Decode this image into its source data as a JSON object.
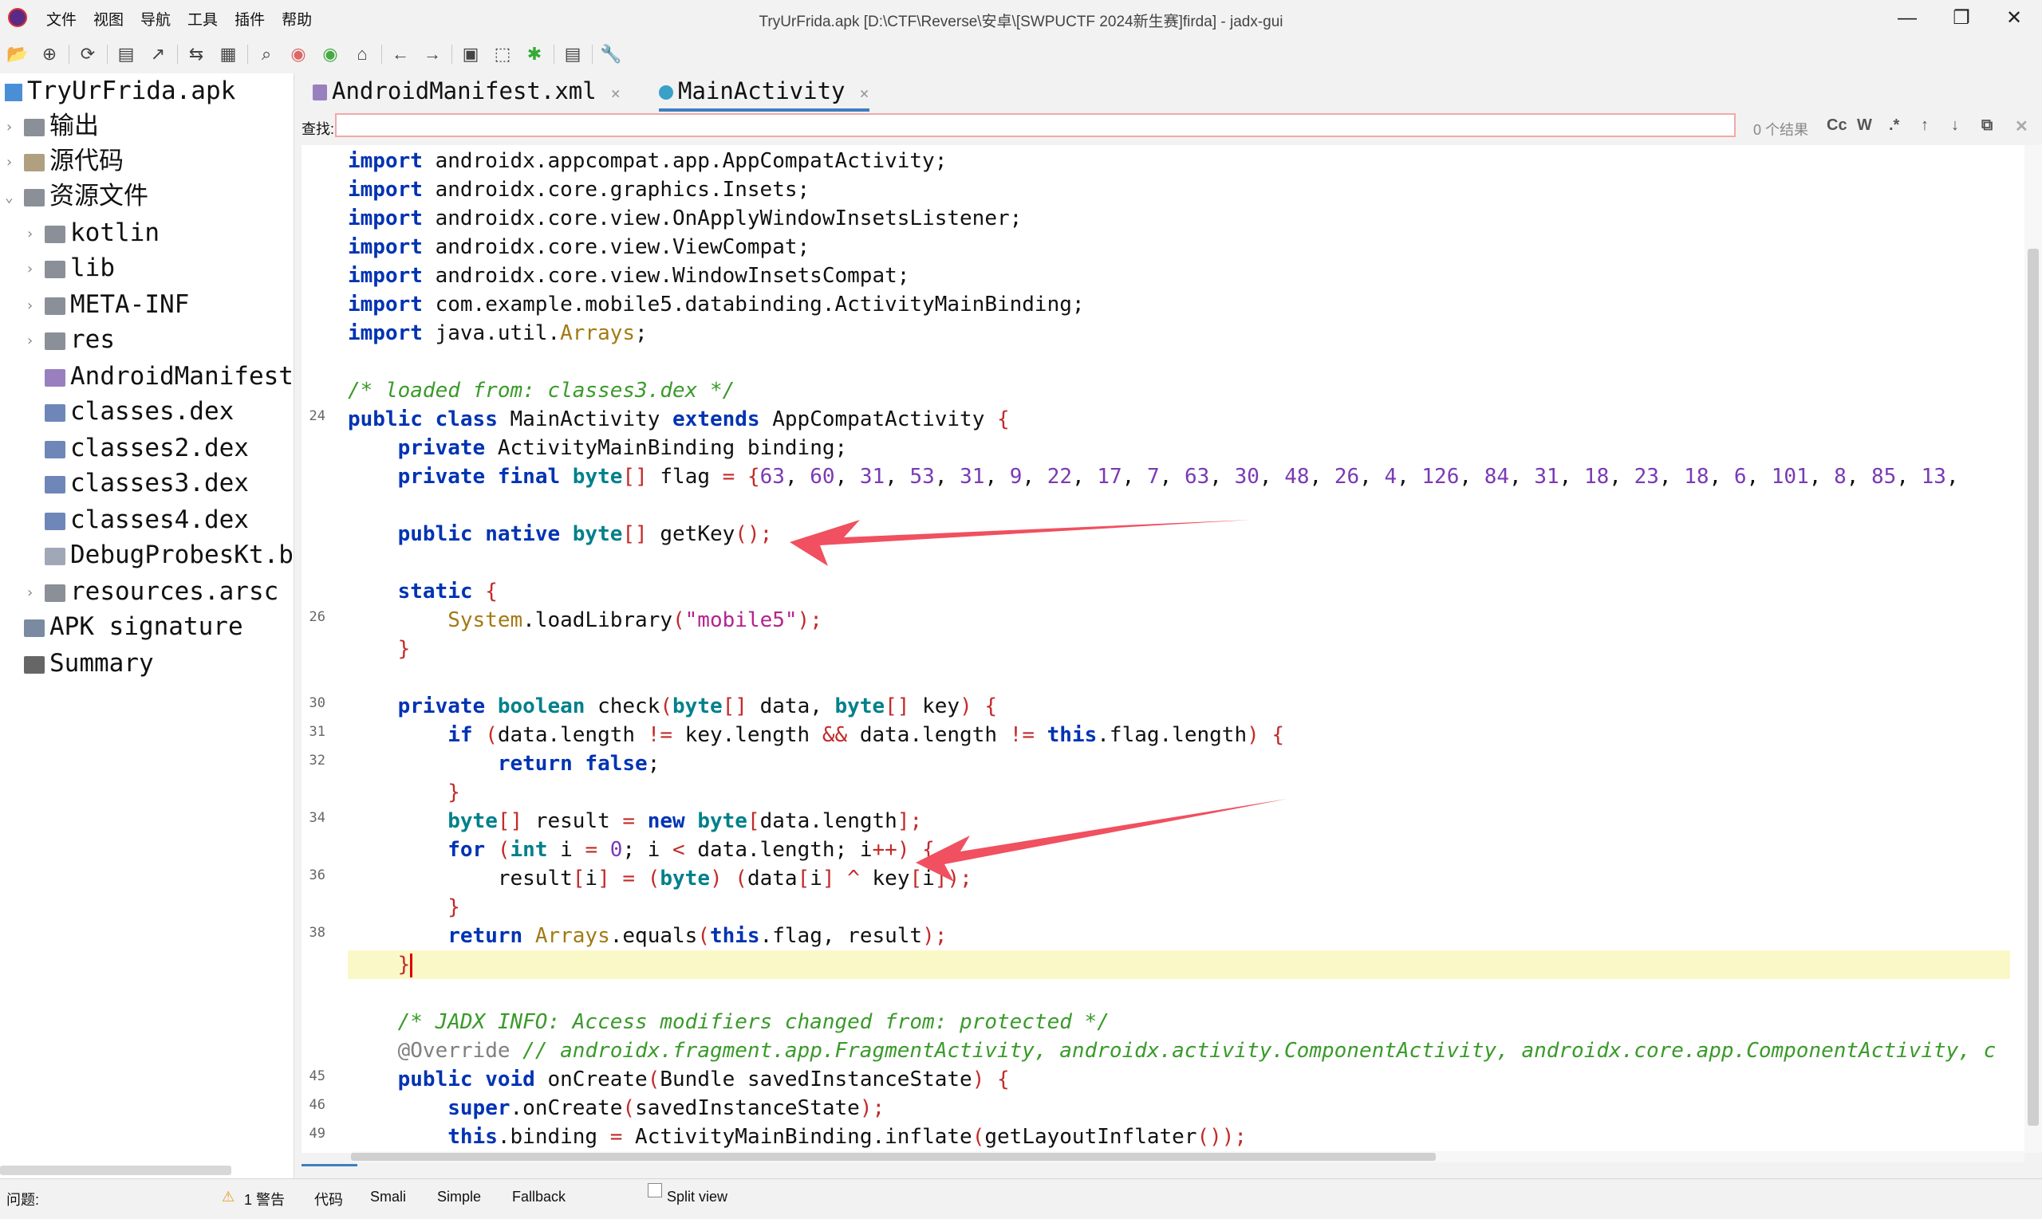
{
  "window": {
    "title": "TryUrFrida.apk [D:\\CTF\\Reverse\\安卓\\[SWPUCTF 2024新生赛]firda] - jadx-gui",
    "menu": [
      "文件",
      "视图",
      "导航",
      "工具",
      "插件",
      "帮助"
    ],
    "controls": {
      "minimize": "—",
      "maximize": "❐",
      "close": "✕"
    }
  },
  "toolbar": {
    "icons": [
      "open-file-icon",
      "add-files-icon",
      "reload-icon",
      "save-icon",
      "export-icon",
      "sync-tree-icon",
      "flatten-packages-icon",
      "search-icon",
      "find-class-icon",
      "usage-search-icon",
      "home-icon",
      "back-icon",
      "forward-icon",
      "quark-icon",
      "bookmark-icon",
      "debug-icon",
      "log-viewer-icon",
      "preferences-icon"
    ]
  },
  "tree": {
    "root": "TryUrFrida.apk",
    "items": [
      {
        "label": "输出",
        "arrow": "›"
      },
      {
        "label": "源代码",
        "arrow": "›"
      },
      {
        "label": "资源文件",
        "arrow": "⌄"
      },
      {
        "label": "kotlin",
        "arrow": "›"
      },
      {
        "label": "lib",
        "arrow": "›"
      },
      {
        "label": "META-INF",
        "arrow": "›"
      },
      {
        "label": "res",
        "arrow": "›"
      },
      {
        "label": "AndroidManifest",
        "arrow": ""
      },
      {
        "label": "classes.dex",
        "arrow": ""
      },
      {
        "label": "classes2.dex",
        "arrow": ""
      },
      {
        "label": "classes3.dex",
        "arrow": ""
      },
      {
        "label": "classes4.dex",
        "arrow": ""
      },
      {
        "label": "DebugProbesKt.b",
        "arrow": ""
      },
      {
        "label": "resources.arsc",
        "arrow": "›"
      },
      {
        "label": "APK signature",
        "arrow": ""
      },
      {
        "label": "Summary",
        "arrow": ""
      }
    ]
  },
  "tabs": [
    {
      "label": "AndroidManifest.xml",
      "close": "×"
    },
    {
      "label": "MainActivity",
      "close": "×"
    }
  ],
  "search": {
    "label": "查找:",
    "placeholder": "",
    "value": "",
    "result_count": "0 个结果",
    "buttons": [
      "Cc",
      "W",
      ".*",
      "↑",
      "↓",
      "⧉",
      "✕"
    ]
  },
  "editor": {
    "line_numbers": {
      "row8": "24",
      "row16": "26",
      "row19": "30",
      "row20": "31",
      "row21": "32",
      "row23": "34",
      "row25": "36",
      "row27": "38",
      "row32": "45",
      "row33": "46",
      "row34": "49"
    },
    "code_lines": [
      "import androidx.appcompat.app.AppCompatActivity;",
      "import androidx.core.graphics.Insets;",
      "import androidx.core.view.OnApplyWindowInsetsListener;",
      "import androidx.core.view.ViewCompat;",
      "import androidx.core.view.WindowInsetsCompat;",
      "import com.example.mobile5.databinding.ActivityMainBinding;",
      "import java.util.Arrays;",
      "",
      "/* loaded from: classes3.dex */",
      "public class MainActivity extends AppCompatActivity {",
      "    private ActivityMainBinding binding;",
      "    private final byte[] flag = {63, 60, 31, 53, 31, 9, 22, 17, 7, 63, 30, 48, 26, 4, 126, 84, 31, 18, 23, 18, 6, 101, 8, 85, 13,",
      "",
      "    public native byte[] getKey();",
      "",
      "    static {",
      "        System.loadLibrary(\"mobile5\");",
      "    }",
      "",
      "    private boolean check(byte[] data, byte[] key) {",
      "        if (data.length != key.length && data.length != this.flag.length) {",
      "            return false;",
      "        }",
      "        byte[] result = new byte[data.length];",
      "        for (int i = 0; i < data.length; i++) {",
      "            result[i] = (byte) (data[i] ^ key[i]);",
      "        }",
      "        return Arrays.equals(this.flag, result);",
      "    }",
      "",
      "    /* JADX INFO: Access modifiers changed from: protected */",
      "    @Override // androidx.fragment.app.FragmentActivity, androidx.activity.ComponentActivity, androidx.core.app.ComponentActivity, c",
      "    public void onCreate(Bundle savedInstanceState) {",
      "        super.onCreate(savedInstanceState);",
      "        this.binding = ActivityMainBinding.inflate(getLayoutInflater());"
    ]
  },
  "bottom": {
    "problems_label": "问题:",
    "warnings": "1 警告",
    "view_tabs": [
      "代码",
      "Smali",
      "Simple",
      "Fallback"
    ],
    "split_view": "Split view"
  },
  "colors": {
    "accent": "#3d7fbf",
    "annotation_arrow": "#f0505f",
    "keyword": "#0033b3",
    "comment": "#3a9a2a",
    "string": "#b4238c",
    "number": "#7a3ab3",
    "highlight_line": "#fbf8c8"
  }
}
